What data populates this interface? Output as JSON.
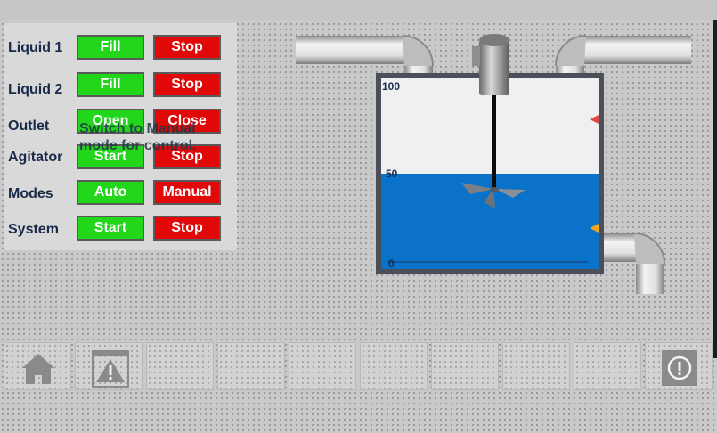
{
  "controls": {
    "rows": [
      {
        "label": "Liquid 1",
        "left": "Fill",
        "right": "Stop"
      },
      {
        "label": "Liquid 2",
        "left": "Fill",
        "right": "Stop"
      },
      {
        "label": "Outlet",
        "left": "Open",
        "right": "Close"
      },
      {
        "label": "Agitator",
        "left": "Start",
        "right": "Stop"
      },
      {
        "label": "Modes",
        "left": "Auto",
        "right": "Manual"
      },
      {
        "label": "System",
        "left": "Start",
        "right": "Stop"
      }
    ],
    "hint": "Switch to Manual mode for control."
  },
  "tank": {
    "level_percent": 50,
    "scale": {
      "top": "100",
      "mid": "50",
      "bottom": "0"
    }
  },
  "nav": {
    "icons": [
      "home-icon",
      "alarm-icon",
      "info-icon"
    ]
  },
  "colors": {
    "green": "#22d61c",
    "red": "#e00808",
    "liquid": "#0a72c8"
  }
}
